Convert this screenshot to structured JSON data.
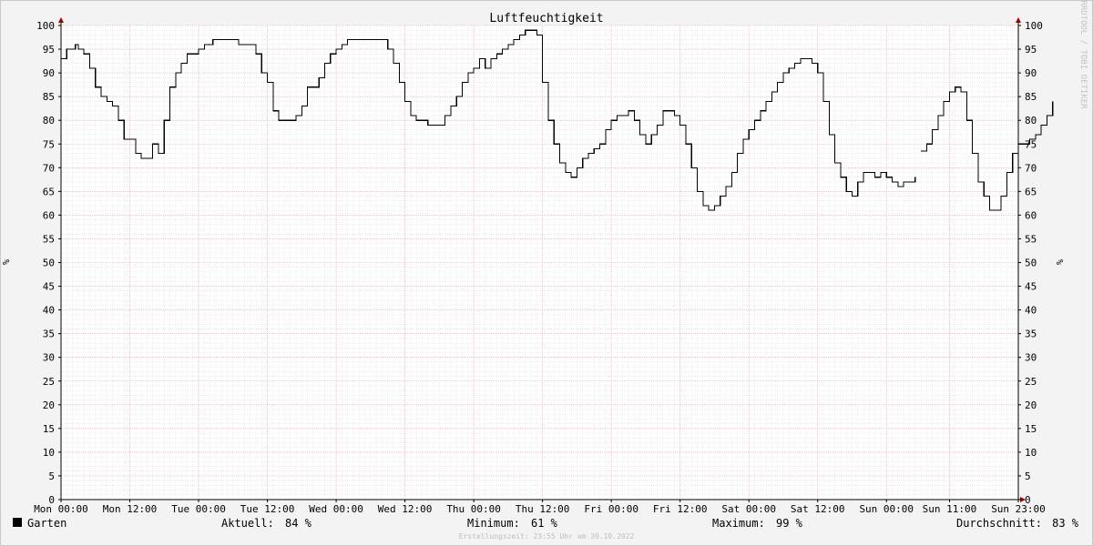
{
  "chart_data": {
    "type": "line",
    "title": "Luftfeuchtigkeit",
    "ylabel": "%",
    "ylim": [
      0,
      100
    ],
    "y_ticks": [
      0,
      5,
      10,
      15,
      20,
      25,
      30,
      35,
      40,
      45,
      50,
      55,
      60,
      65,
      70,
      75,
      80,
      85,
      90,
      95,
      100
    ],
    "x_tick_labels": [
      "Mon 00:00",
      "Mon 12:00",
      "Tue 00:00",
      "Tue 12:00",
      "Wed 00:00",
      "Wed 12:00",
      "Thu 00:00",
      "Thu 12:00",
      "Fri 00:00",
      "Fri 12:00",
      "Sat 00:00",
      "Sat 12:00",
      "Sun 00:00",
      "Sun 11:00",
      "Sun 23:00"
    ],
    "x_tick_hours": [
      0,
      12,
      24,
      36,
      48,
      60,
      72,
      84,
      96,
      108,
      120,
      132,
      144,
      155,
      167
    ],
    "x_range_hours": [
      0,
      167
    ],
    "grid": true,
    "watermark": "RRDTOOL / TOBI OETIKER",
    "series": [
      {
        "name": "Garten",
        "color": "#000000",
        "segments": [
          [
            [
              0,
              93
            ],
            [
              1,
              95
            ],
            [
              2,
              95
            ],
            [
              2.5,
              96
            ],
            [
              3,
              95
            ],
            [
              4,
              94
            ],
            [
              5,
              91
            ],
            [
              6,
              87
            ],
            [
              7,
              85
            ],
            [
              8,
              84
            ],
            [
              9,
              83
            ],
            [
              10,
              80
            ],
            [
              11,
              76
            ],
            [
              12,
              76
            ],
            [
              13,
              73
            ],
            [
              14,
              72
            ],
            [
              15,
              72
            ],
            [
              16,
              75
            ],
            [
              17,
              73
            ],
            [
              18,
              80
            ],
            [
              19,
              87
            ],
            [
              20,
              90
            ],
            [
              21,
              92
            ],
            [
              22,
              94
            ],
            [
              23,
              94
            ],
            [
              24,
              95
            ],
            [
              25,
              96
            ],
            [
              26,
              96
            ],
            [
              26.5,
              97
            ],
            [
              27,
              97
            ],
            [
              28,
              97
            ],
            [
              29,
              97
            ],
            [
              30,
              97
            ],
            [
              31,
              96
            ],
            [
              32,
              96
            ],
            [
              33,
              96
            ],
            [
              34,
              94
            ],
            [
              35,
              90
            ],
            [
              36,
              88
            ],
            [
              37,
              82
            ],
            [
              38,
              80
            ],
            [
              39,
              80
            ],
            [
              40,
              80
            ],
            [
              41,
              81
            ],
            [
              42,
              83
            ],
            [
              43,
              87
            ],
            [
              44,
              87
            ],
            [
              45,
              89
            ],
            [
              46,
              92
            ],
            [
              47,
              94
            ],
            [
              48,
              95
            ],
            [
              49,
              96
            ],
            [
              50,
              97
            ],
            [
              51,
              97
            ],
            [
              52,
              97
            ],
            [
              53,
              97
            ],
            [
              54,
              97
            ],
            [
              55,
              97
            ],
            [
              56,
              97
            ],
            [
              57,
              95
            ],
            [
              58,
              92
            ],
            [
              59,
              88
            ],
            [
              60,
              84
            ],
            [
              61,
              81
            ],
            [
              62,
              80
            ],
            [
              63,
              80
            ],
            [
              64,
              79
            ],
            [
              65,
              79
            ],
            [
              66,
              79
            ],
            [
              67,
              81
            ],
            [
              68,
              83
            ],
            [
              69,
              85
            ],
            [
              70,
              88
            ],
            [
              71,
              90
            ],
            [
              72,
              91
            ],
            [
              73,
              93
            ],
            [
              74,
              91
            ],
            [
              75,
              93
            ],
            [
              76,
              94
            ],
            [
              77,
              95
            ],
            [
              78,
              96
            ],
            [
              79,
              97
            ],
            [
              80,
              98
            ],
            [
              81,
              99
            ],
            [
              82,
              99
            ],
            [
              83,
              98
            ],
            [
              84,
              88
            ],
            [
              85,
              80
            ],
            [
              86,
              75
            ],
            [
              87,
              71
            ],
            [
              88,
              69
            ],
            [
              89,
              68
            ],
            [
              90,
              70
            ],
            [
              91,
              72
            ],
            [
              92,
              73
            ],
            [
              93,
              74
            ],
            [
              94,
              75
            ],
            [
              95,
              78
            ],
            [
              96,
              80
            ],
            [
              97,
              81
            ],
            [
              98,
              81
            ],
            [
              99,
              82
            ],
            [
              100,
              80
            ],
            [
              101,
              77
            ],
            [
              102,
              75
            ],
            [
              103,
              77
            ],
            [
              104,
              79
            ],
            [
              105,
              82
            ],
            [
              106,
              82
            ],
            [
              107,
              81
            ],
            [
              108,
              79
            ],
            [
              109,
              75
            ],
            [
              110,
              70
            ],
            [
              111,
              65
            ],
            [
              112,
              62
            ],
            [
              113,
              61
            ],
            [
              114,
              62
            ],
            [
              115,
              64
            ],
            [
              116,
              66
            ],
            [
              117,
              69
            ],
            [
              118,
              73
            ],
            [
              119,
              76
            ],
            [
              120,
              78
            ],
            [
              121,
              80
            ],
            [
              122,
              82
            ],
            [
              123,
              84
            ],
            [
              124,
              86
            ],
            [
              125,
              88
            ],
            [
              126,
              90
            ],
            [
              127,
              91
            ],
            [
              128,
              92
            ],
            [
              129,
              93
            ],
            [
              130,
              93
            ],
            [
              131,
              92
            ],
            [
              132,
              90
            ],
            [
              133,
              84
            ],
            [
              134,
              77
            ],
            [
              135,
              71
            ],
            [
              136,
              68
            ],
            [
              137,
              65
            ],
            [
              138,
              64
            ],
            [
              139,
              67
            ],
            [
              140,
              69
            ],
            [
              141,
              69
            ],
            [
              142,
              68
            ],
            [
              143,
              69
            ],
            [
              144,
              68
            ],
            [
              145,
              67
            ],
            [
              146,
              66
            ],
            [
              147,
              67
            ],
            [
              148,
              67
            ],
            [
              149,
              68
            ]
          ],
          [
            [
              150,
              73.5
            ],
            [
              151,
              75
            ],
            [
              152,
              78
            ],
            [
              153,
              81
            ],
            [
              154,
              84
            ],
            [
              155,
              86
            ],
            [
              156,
              87
            ],
            [
              157,
              86
            ],
            [
              158,
              80
            ],
            [
              159,
              73
            ],
            [
              160,
              67
            ],
            [
              161,
              64
            ],
            [
              162,
              61
            ],
            [
              163,
              61
            ],
            [
              164,
              64
            ],
            [
              165,
              69
            ],
            [
              166,
              73
            ],
            [
              167,
              75
            ],
            [
              168,
              75
            ],
            [
              169,
              76
            ],
            [
              170,
              77
            ],
            [
              171,
              79
            ],
            [
              172,
              81
            ],
            [
              173,
              84
            ]
          ]
        ]
      }
    ],
    "legend": {
      "label": "Garten",
      "aktuell_label": "Aktuell:",
      "aktuell_value": "84 %",
      "minimum_label": "Minimum:",
      "minimum_value": "61 %",
      "maximum_label": "Maximum:",
      "maximum_value": "99 %",
      "durchschnitt_label": "Durchschnitt:",
      "durchschnitt_value": "83 %"
    },
    "footer": "Erstellungszeit: 23:55 Uhr am 30.10.2022"
  }
}
